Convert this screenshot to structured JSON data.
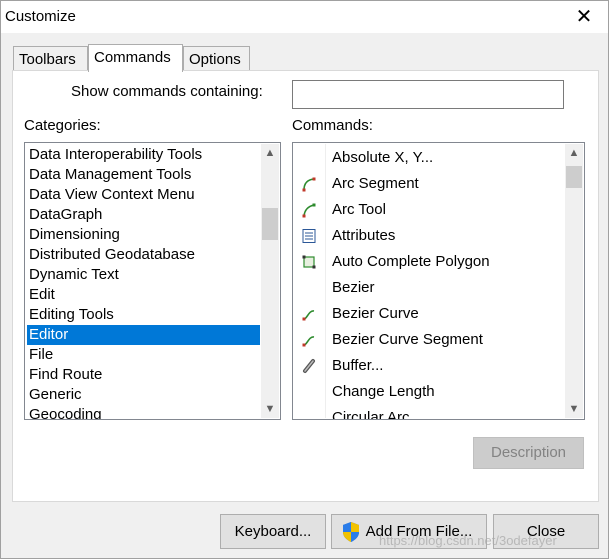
{
  "window": {
    "title": "Customize",
    "close_glyph": "✕"
  },
  "tabs": [
    {
      "label": "Toolbars",
      "active": false
    },
    {
      "label": "Commands",
      "active": true
    },
    {
      "label": "Options",
      "active": false
    }
  ],
  "search": {
    "label": "Show commands containing:",
    "value": ""
  },
  "categories": {
    "label": "Categories:",
    "selected": "Editor",
    "items": [
      "Data Interoperability Tools",
      "Data Management Tools",
      "Data View Context Menu",
      "DataGraph",
      "Dimensioning",
      "Distributed Geodatabase",
      "Dynamic Text",
      "Edit",
      "Editing Tools",
      "Editor",
      "File",
      "Find Route",
      "Generic",
      "Geocoding"
    ]
  },
  "commands": {
    "label": "Commands:",
    "items": [
      {
        "label": "Absolute X, Y...",
        "icon": "none"
      },
      {
        "label": "Arc Segment",
        "icon": "arc-segment-icon"
      },
      {
        "label": "Arc Tool",
        "icon": "arc-tool-icon"
      },
      {
        "label": "Attributes",
        "icon": "attributes-icon"
      },
      {
        "label": "Auto Complete Polygon",
        "icon": "auto-complete-polygon-icon"
      },
      {
        "label": "Bezier",
        "icon": "none"
      },
      {
        "label": "Bezier Curve",
        "icon": "bezier-curve-icon"
      },
      {
        "label": "Bezier Curve Segment",
        "icon": "bezier-curve-segment-icon"
      },
      {
        "label": "Buffer...",
        "icon": "buffer-icon"
      },
      {
        "label": "Change Length",
        "icon": "none"
      },
      {
        "label": "Circular Arc",
        "icon": "none"
      }
    ]
  },
  "buttons": {
    "description": "Description",
    "keyboard": "Keyboard...",
    "add_from_file": "Add From File...",
    "close": "Close"
  },
  "watermark": "https://blog.csdn.net/3odefayer",
  "colors": {
    "selection": "#0078d7",
    "icon_green": "#2e8b2e",
    "icon_red": "#c0392b"
  }
}
